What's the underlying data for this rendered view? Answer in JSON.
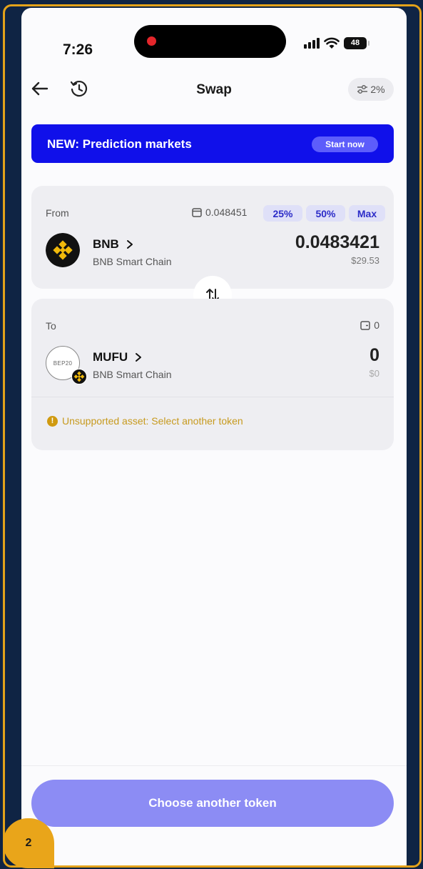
{
  "status_bar": {
    "time": "7:26",
    "battery": "48"
  },
  "header": {
    "title": "Swap",
    "slippage": "2%"
  },
  "banner": {
    "text": "NEW: Prediction markets",
    "button": "Start now"
  },
  "from": {
    "label": "From",
    "balance": "0.048451",
    "percent_buttons": [
      "25%",
      "50%",
      "Max"
    ],
    "token": {
      "symbol": "BNB",
      "chain": "BNB Smart Chain"
    },
    "amount": "0.0483421",
    "usd": "$29.53"
  },
  "to": {
    "label": "To",
    "balance": "0",
    "token": {
      "symbol": "MUFU",
      "chain": "BNB Smart Chain",
      "icon_text": "BEP20"
    },
    "amount": "0",
    "usd": "$0"
  },
  "warning": "Unsupported asset: Select another token",
  "cta": "Choose another token",
  "step_badge": "2",
  "colors": {
    "accent": "#1010ea",
    "warning": "#c79a1e",
    "cta": "#8c8cf4",
    "frame": "#e3a21a"
  }
}
